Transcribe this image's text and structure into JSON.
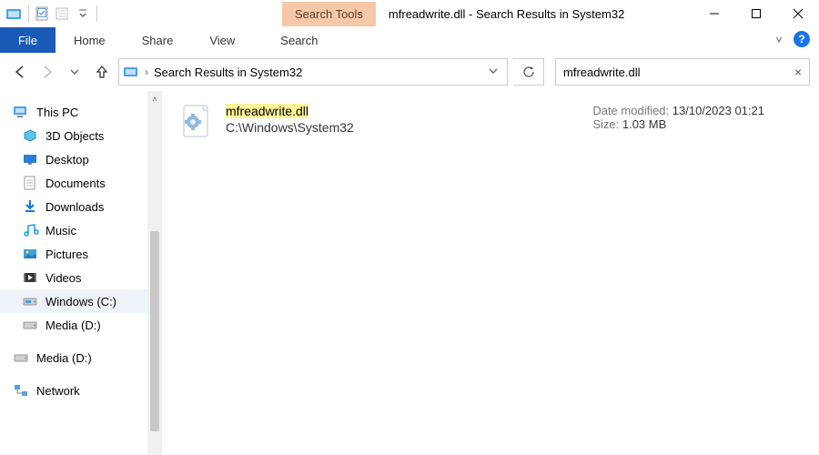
{
  "title_bar": {
    "search_tools_tab": "Search Tools",
    "window_title": "mfreadwrite.dll - Search Results in System32"
  },
  "ribbon": {
    "file": "File",
    "home": "Home",
    "share": "Share",
    "view": "View",
    "search": "Search",
    "expand_glyph": "˅",
    "help_glyph": "?"
  },
  "nav": {
    "back_tooltip": "Back",
    "forward_tooltip": "Forward",
    "recent_tooltip": "Recent locations",
    "up_tooltip": "Up",
    "address_sep": "›",
    "address_text": "Search Results in System32",
    "refresh_tooltip": "Refresh",
    "search_value": "mfreadwrite.dll",
    "clear_glyph": "×"
  },
  "navpane": {
    "this_pc": "This PC",
    "items": [
      {
        "label": "3D Objects",
        "icon": "3d"
      },
      {
        "label": "Desktop",
        "icon": "desktop"
      },
      {
        "label": "Documents",
        "icon": "documents"
      },
      {
        "label": "Downloads",
        "icon": "downloads"
      },
      {
        "label": "Music",
        "icon": "music"
      },
      {
        "label": "Pictures",
        "icon": "pictures"
      },
      {
        "label": "Videos",
        "icon": "videos"
      },
      {
        "label": "Windows (C:)",
        "icon": "drive",
        "selected": true
      },
      {
        "label": "Media (D:)",
        "icon": "drive"
      }
    ],
    "media_d": "Media (D:)",
    "network": "Network"
  },
  "result": {
    "name": "mfreadwrite.dll",
    "path": "C:\\Windows\\System32",
    "date_label": "Date modified:",
    "date_value": "13/10/2023 01:21",
    "size_label": "Size:",
    "size_value": "1.03 MB"
  },
  "scroll_up_glyph": "˄"
}
